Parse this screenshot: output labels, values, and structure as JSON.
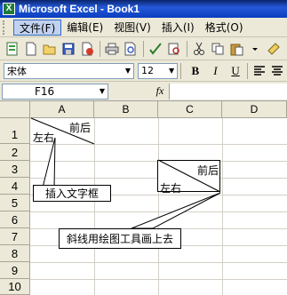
{
  "window": {
    "title": "Microsoft Excel - Book1",
    "app_icon": "X"
  },
  "menu": [
    {
      "label": "文件(F)",
      "active": true
    },
    {
      "label": "编辑(E)"
    },
    {
      "label": "视图(V)"
    },
    {
      "label": "插入(I)"
    },
    {
      "label": "格式(O)"
    }
  ],
  "toolbar": {
    "icons": [
      "excel-doc-icon",
      "new-icon",
      "open-icon",
      "save-icon",
      "permission-icon",
      "print-icon",
      "print-preview-icon",
      "spelling-icon",
      "research-icon",
      "cut-icon",
      "copy-icon",
      "paste-icon",
      "format-painter-icon"
    ]
  },
  "format": {
    "font": "宋体",
    "size": "12",
    "bold": "B",
    "italic": "I",
    "underline": "U"
  },
  "formula": {
    "name_box": "F16",
    "fx": "fx",
    "value": ""
  },
  "sheet": {
    "columns": [
      "A",
      "B",
      "C",
      "D"
    ],
    "rows": [
      "1",
      "2",
      "3",
      "4",
      "5",
      "6",
      "7",
      "8",
      "9",
      "10"
    ],
    "a1_top_right": "前后",
    "a1_bottom_left": "左右",
    "box_top_right": "前后",
    "box_bottom_left": "左右",
    "callout_textbox": "插入文字框",
    "callout_drawing": "斜线用绘图工具画上去"
  }
}
